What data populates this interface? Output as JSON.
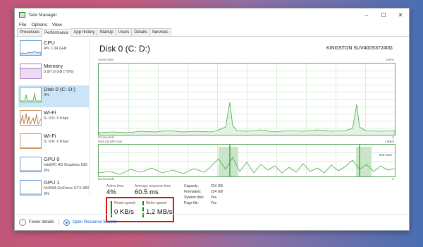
{
  "window": {
    "title": "Task Manager"
  },
  "menu": [
    "File",
    "Options",
    "View"
  ],
  "tabs": [
    "Processes",
    "Performance",
    "App history",
    "Startup",
    "Users",
    "Details",
    "Services"
  ],
  "sidebar": {
    "items": [
      {
        "title": "CPU",
        "sub": "4% 1.04 GHz",
        "color": "#3a78c3"
      },
      {
        "title": "Memory",
        "sub": "5.9/7.8 GB (75%)",
        "color": "#8b3aa8"
      },
      {
        "title": "Disk 0 (C: D:)",
        "sub": "4%",
        "color": "#4aa84a"
      },
      {
        "title": "Wi-Fi",
        "sub": "S: 0 R: 0 Kbps",
        "color": "#a86a2a"
      },
      {
        "title": "Wi-Fi",
        "sub": "S: 0 R: 0 Kbps",
        "color": "#a86a2a"
      },
      {
        "title": "GPU 0",
        "sub": "Intel(R) HD Graphics 530",
        "sub2": "0%",
        "color": "#3a78c3"
      },
      {
        "title": "GPU 1",
        "sub": "NVIDIA GeForce GTX 960",
        "sub2": "0%",
        "color": "#3a78c3"
      }
    ]
  },
  "main": {
    "title": "Disk 0 (C: D:)",
    "model": "KINGSTON SUV400S37240G",
    "graph1": {
      "label": "Active time",
      "max": "100%",
      "time": "60 seconds",
      "min": "0"
    },
    "graph2": {
      "label": "Disk transfer rate",
      "max": "1 MB/s",
      "mid": "600 KB/s",
      "time": "60 seconds",
      "min": "0"
    }
  },
  "stats": {
    "active_time": {
      "label": "Active time",
      "value": "4%"
    },
    "response": {
      "label": "Average response time",
      "value": "60.5 ms"
    },
    "read": {
      "label": "Read speed",
      "value": "0 KB/s"
    },
    "write": {
      "label": "Write speed",
      "value": "1.2 MB/s"
    },
    "props": [
      {
        "label": "Capacity:",
        "value": "224 GB"
      },
      {
        "label": "Formatted:",
        "value": "224 GB"
      },
      {
        "label": "System disk:",
        "value": "Yes"
      },
      {
        "label": "Page file:",
        "value": "Yes"
      }
    ]
  },
  "footer": {
    "fewer": "Fewer details",
    "monitor": "Open Resource Monitor"
  },
  "colors": {
    "disk_line": "#4aa84a",
    "disk_fill": "#e3f3e3",
    "highlight": "#e01010"
  }
}
